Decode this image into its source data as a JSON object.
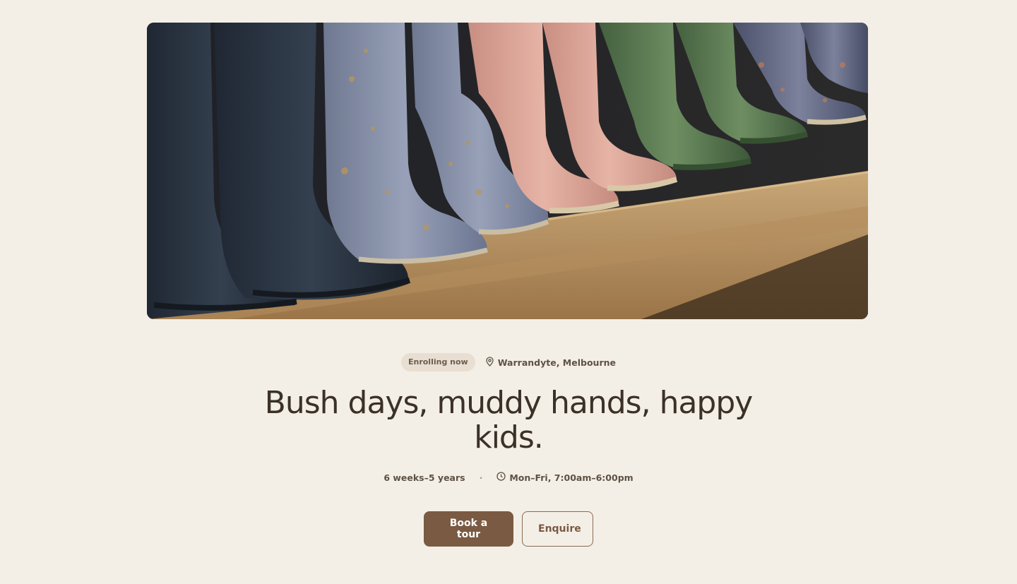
{
  "hero": {
    "image_alt": "Row of muddy children's gumboots on a wooden shelf",
    "image_icon": "gumboots-photo"
  },
  "meta": {
    "badge": "Enrolling now",
    "location": "Warrandyte, Melbourne",
    "location_icon": "map-pin-icon"
  },
  "headline": "Bush days, muddy hands, happy kids.",
  "details": {
    "ages": "6 weeks–5 years",
    "separator": "·",
    "hours": "Mon–Fri, 7:00am–6:00pm",
    "hours_icon": "clock-icon"
  },
  "actions": {
    "primary_label": "Book a tour",
    "secondary_label": "Enquire"
  },
  "colors": {
    "background": "#f3efe7",
    "primary": "#7a5a42",
    "badge_bg": "#e8dfd2",
    "text": "#3b3128"
  }
}
